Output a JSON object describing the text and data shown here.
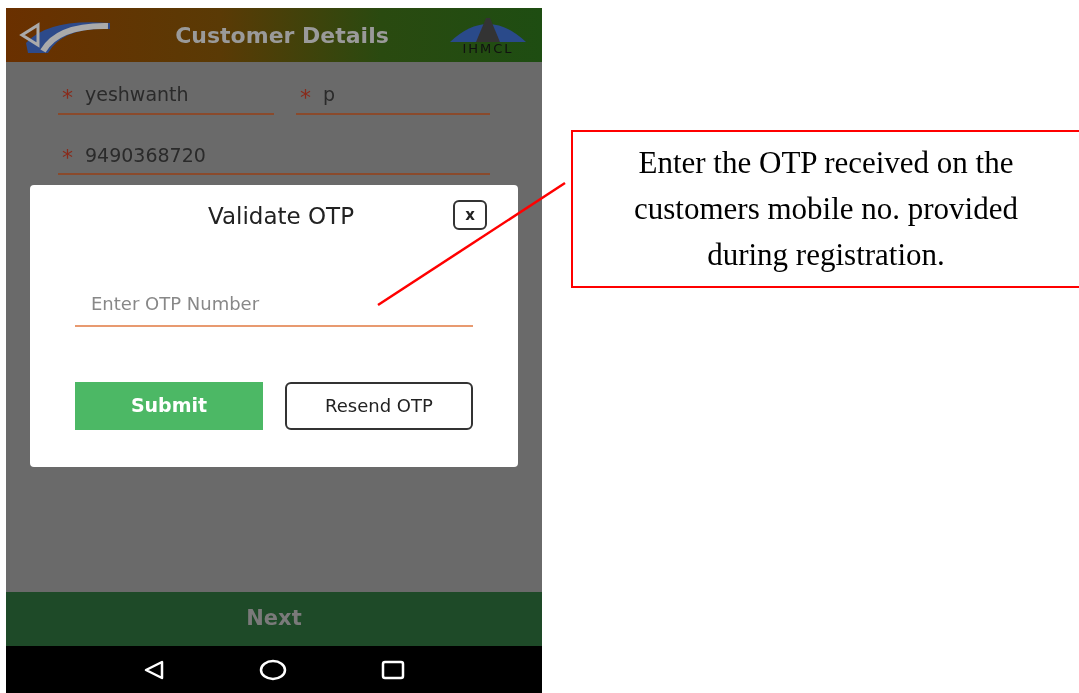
{
  "header": {
    "title": "Customer Details",
    "right_logo_text": "IHMCL"
  },
  "fields": [
    {
      "required_mark": "*",
      "value": "yeshwanth"
    },
    {
      "required_mark": "*",
      "value": "p"
    },
    {
      "required_mark": "*",
      "value": "9490368720"
    }
  ],
  "dialog": {
    "title": "Validate OTP",
    "close": "x",
    "otp_field": {
      "placeholder": "Enter OTP Number"
    },
    "buttons": [
      {
        "kind": "primary",
        "label": "Submit"
      },
      {
        "kind": "outline",
        "label": "Resend OTP"
      }
    ]
  },
  "footer_button": {
    "label": "Next",
    "disabled": true
  },
  "callout": {
    "text": "Enter the OTP received on the customers mobile no. provided during registration."
  }
}
